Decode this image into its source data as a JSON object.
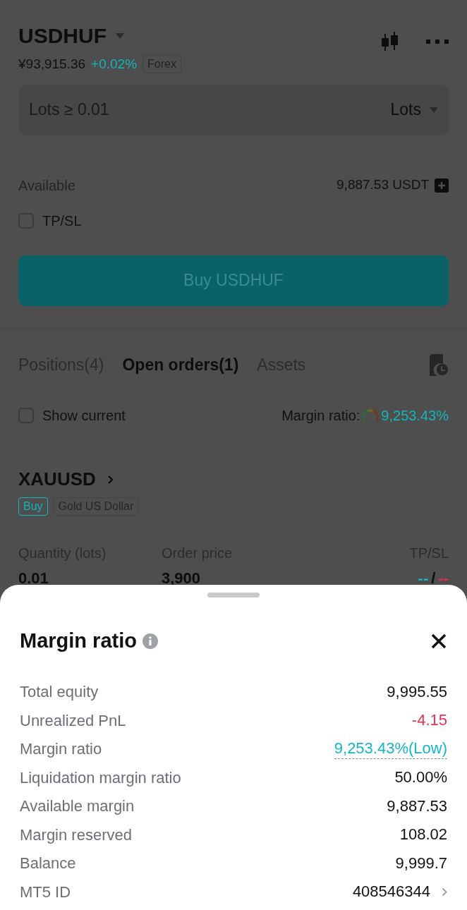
{
  "header": {
    "symbol": "USDHUF",
    "price": "¥93,915.36",
    "change": "+0.02%",
    "tag": "Forex"
  },
  "order_form": {
    "placeholder": "Lots ≥ 0.01",
    "unit": "Lots",
    "available_label": "Available",
    "available_value": "9,887.53 USDT",
    "tpsl": {
      "label": "TP/SL",
      "checked": false
    },
    "submit": "Buy USDHUF"
  },
  "tabs": [
    {
      "label": "Positions(4)",
      "selected": false
    },
    {
      "label": "Open orders(1)",
      "selected": true
    },
    {
      "label": "Assets",
      "selected": false
    }
  ],
  "filter": {
    "label": "Show current",
    "checked": false
  },
  "margin_summary": {
    "label": "Margin ratio:",
    "value": "9,253.43%"
  },
  "order": {
    "symbol": "XAUUSD",
    "side": "Buy",
    "name": "Gold US Dollar",
    "fields": [
      {
        "label": "Quantity (lots)",
        "value": "0.01"
      },
      {
        "label": "Order price",
        "value": "3,900"
      }
    ],
    "tpsl_label": "TP/SL",
    "tp": "--",
    "separator": "/",
    "sl": "--"
  },
  "sheet": {
    "title": "Margin ratio",
    "rows": [
      {
        "label": "Total equity",
        "value": "9,995.55",
        "kind": "plain"
      },
      {
        "label": "Unrealized PnL",
        "value": "-4.15",
        "kind": "negative"
      },
      {
        "label": "Margin ratio",
        "value": "9,253.43%(Low)",
        "kind": "tip"
      },
      {
        "label": "Liquidation margin ratio",
        "value": "50.00%",
        "kind": "plain"
      },
      {
        "label": "Available margin",
        "value": "9,887.53",
        "kind": "plain"
      },
      {
        "label": "Margin reserved",
        "value": "108.02",
        "kind": "plain"
      },
      {
        "label": "Balance",
        "value": "9,999.7",
        "kind": "plain"
      },
      {
        "label": "MT5 ID",
        "value": "408546344",
        "kind": "link"
      }
    ]
  }
}
